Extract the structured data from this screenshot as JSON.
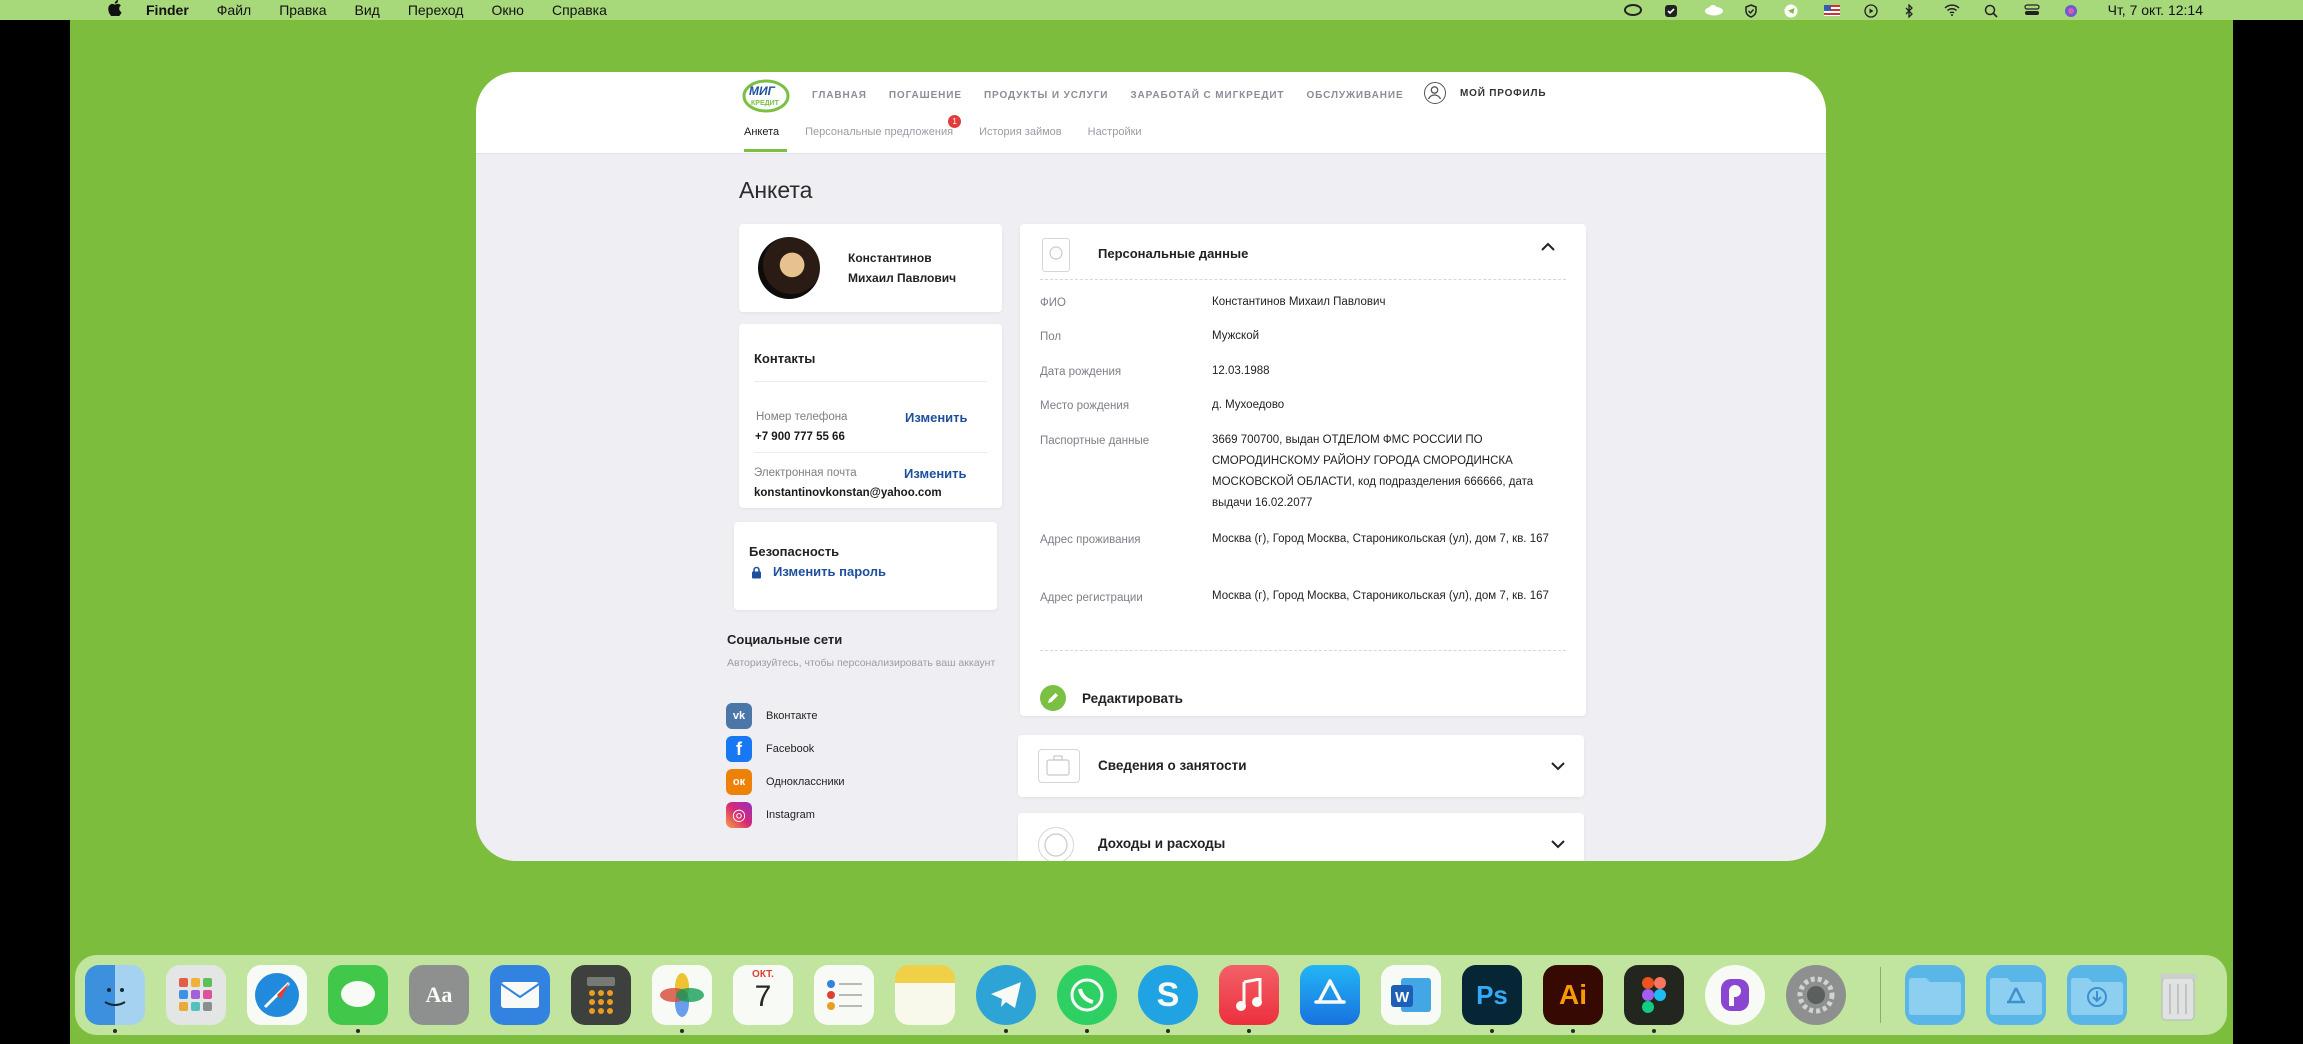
{
  "menubar": {
    "app_name": "Finder",
    "items": [
      "Файл",
      "Правка",
      "Вид",
      "Переход",
      "Окно",
      "Справка"
    ],
    "clock": "Чт, 7 окт.  12:14"
  },
  "site": {
    "logo_text_top": "МИГ",
    "logo_text_bottom": "КРЕДИТ",
    "nav": [
      "ГЛАВНАЯ",
      "ПОГАШЕНИЕ",
      "ПРОДУКТЫ И УСЛУГИ",
      "ЗАРАБОТАЙ С МИГКРЕДИТ",
      "ОБСЛУЖИВАНИЕ"
    ],
    "profile_label": "МОЙ ПРОФИЛЬ",
    "tabs": [
      {
        "label": "Анкета",
        "active": true
      },
      {
        "label": "Персональные предложения",
        "badge": "1"
      },
      {
        "label": "История займов"
      },
      {
        "label": "Настройки"
      }
    ],
    "page_title": "Анкета"
  },
  "profile": {
    "name_line1": "Константинов",
    "name_line2": "Михаил Павлович"
  },
  "contacts": {
    "title": "Контакты",
    "phone_label": "Номер телефона",
    "phone_value": "+7 900 777 55 66",
    "email_label": "Электронная почта",
    "email_value": "konstantinovkonstan@yahoo.com",
    "change_label": "Изменить"
  },
  "security": {
    "title": "Безопасность",
    "change_password": "Изменить пароль"
  },
  "social": {
    "title": "Социальные сети",
    "hint": "Авторизуйтесь, чтобы персонализировать ваш аккаунт",
    "items": [
      {
        "label": "Вконтакте",
        "icon": "vk-icon",
        "color": "#4a76a8",
        "glyph": "vk"
      },
      {
        "label": "Facebook",
        "icon": "facebook-icon",
        "color": "#1877f2",
        "glyph": "f"
      },
      {
        "label": "Одноклассники",
        "icon": "odnoklassniki-icon",
        "color": "#ee8208",
        "glyph": "ок"
      },
      {
        "label": "Instagram",
        "icon": "instagram-icon",
        "color": "#c13584",
        "glyph": "◎"
      }
    ]
  },
  "personal": {
    "title": "Персональные данные",
    "rows": [
      {
        "label": "ФИО",
        "value": "Константинов Михаил Павлович"
      },
      {
        "label": "Пол",
        "value": "Мужской"
      },
      {
        "label": "Дата рождения",
        "value": "12.03.1988"
      },
      {
        "label": "Место рождения",
        "value": "д. Мухоедово"
      },
      {
        "label": "Паспортные данные",
        "value": "3669 700700, выдан ОТДЕЛОМ ФМС РОССИИ ПО СМОРОДИНСКОМУ РАЙОНУ ГОРОДА СМОРОДИНСКА МОСКОВСКОЙ ОБЛАСТИ, код подразделения 666666, дата выдачи 16.02.2077"
      },
      {
        "label": "Адрес проживания",
        "value": "Москва (г), Город Москва, Староникольская (ул), дом 7, кв. 167"
      },
      {
        "label": "Адрес регистрации",
        "value": "Москва (г), Город Москва, Староникольская (ул), дом 7, кв. 167"
      }
    ],
    "edit_label": "Редактировать"
  },
  "accordions": [
    {
      "label": "Сведения о занятости"
    },
    {
      "label": "Доходы и расходы"
    }
  ],
  "dock": {
    "calendar_month": "ОКТ.",
    "calendar_day": "7"
  }
}
